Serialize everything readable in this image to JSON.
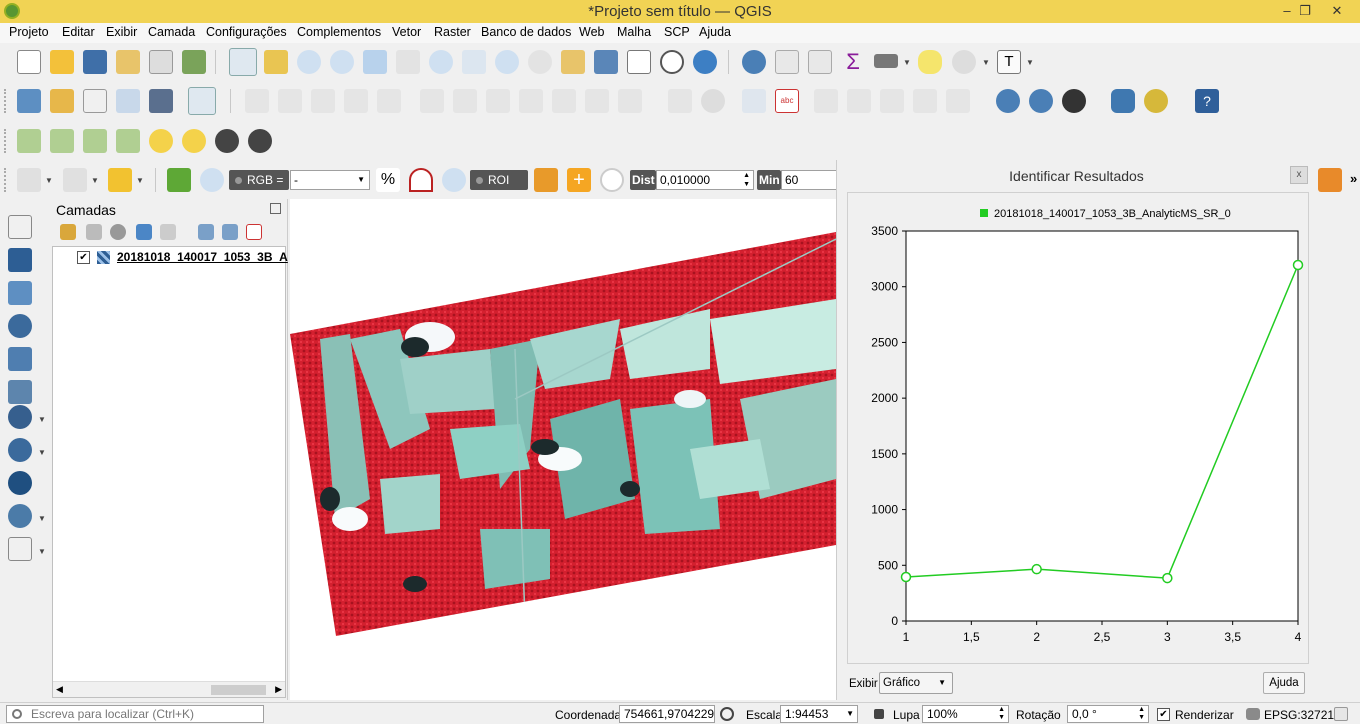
{
  "window": {
    "title": "*Projeto sem título — QGIS",
    "minimize": "–",
    "restore": "❐",
    "close": "✕"
  },
  "menu": [
    "Projeto",
    "Editar",
    "Exibir",
    "Camada",
    "Configurações",
    "Complementos",
    "Vetor",
    "Raster",
    "Banco de dados",
    "Web",
    "Malha",
    "SCP",
    "Ajuda"
  ],
  "scp_toolbar": {
    "rgb_label": "RGB =",
    "rgb_value": "-",
    "roi_label": "ROI",
    "dist_label": "Dist",
    "dist_value": "0,010000",
    "min_label": "Min",
    "min_value": "60"
  },
  "layers_panel": {
    "title": "Camadas",
    "layer_name": "20181018_140017_1053_3B_A",
    "layer_checked": "✔"
  },
  "identify_panel": {
    "title": "Identificar Resultados",
    "close": "x",
    "view_label": "Exibir",
    "view_value": "Gráfico",
    "help_button": "Ajuda"
  },
  "chart_data": {
    "type": "line",
    "series": [
      {
        "name": "20181018_140017_1053_3B_AnalyticMS_SR_0",
        "color": "#22cc22",
        "x": [
          1,
          2,
          3,
          4
        ],
        "y": [
          395,
          465,
          385,
          3195
        ]
      }
    ],
    "xlim": [
      1,
      4
    ],
    "ylim": [
      0,
      3500
    ],
    "xticks": [
      "1",
      "1,5",
      "2",
      "2,5",
      "3",
      "3,5",
      "4"
    ],
    "yticks": [
      "0",
      "500",
      "1000",
      "1500",
      "2000",
      "2500",
      "3000",
      "3500"
    ],
    "legend_position": "top"
  },
  "status": {
    "search_placeholder": "Escreva para localizar (Ctrl+K)",
    "coord_label": "Coordenada",
    "coord_value": "754661,9704229",
    "scale_label": "Escala",
    "scale_value": "1:94453",
    "magnifier_label": "Lupa",
    "magnifier_value": "100%",
    "rotation_label": "Rotação",
    "rotation_value": "0,0 °",
    "render_label": "Renderizar",
    "crs": "EPSG:32721"
  }
}
